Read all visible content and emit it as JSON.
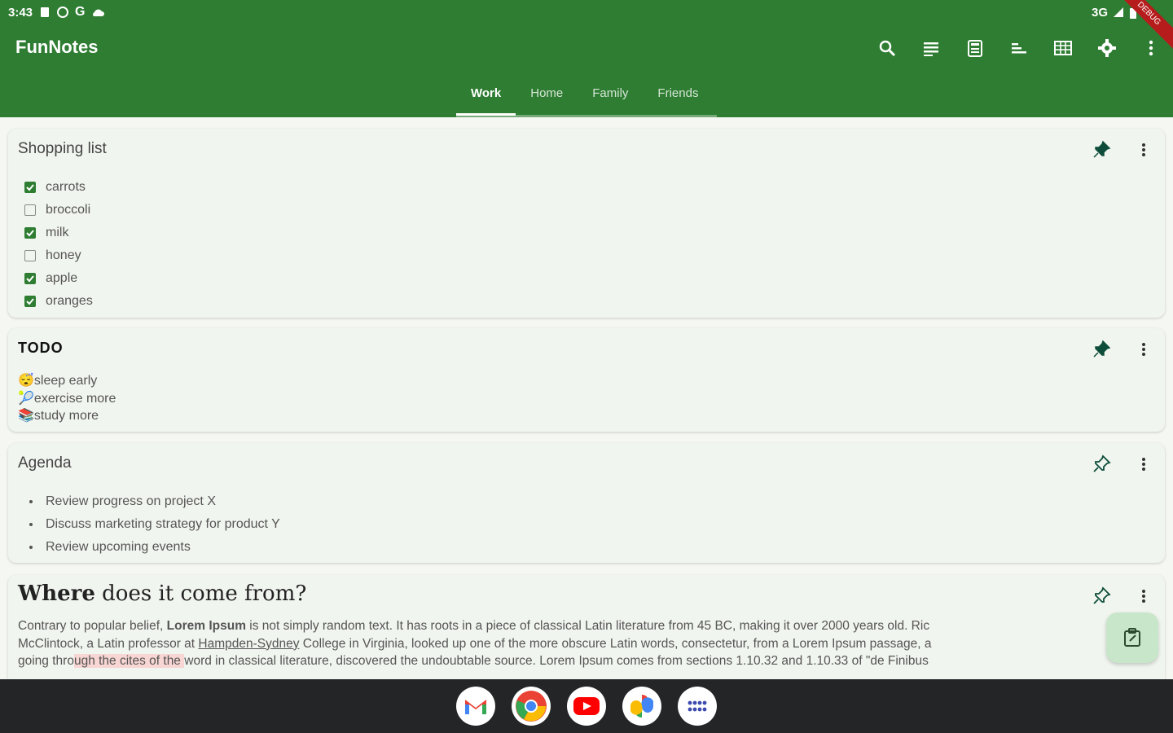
{
  "status": {
    "time": "3:43",
    "network": "3G"
  },
  "debug_banner": "DEBUG",
  "app": {
    "title": "FunNotes"
  },
  "toolbar_icons": [
    "search-icon",
    "list-view-icon",
    "calculator-icon",
    "sort-icon",
    "grid-view-icon",
    "settings-icon",
    "more-vert-icon"
  ],
  "tabs": [
    {
      "label": "Work",
      "active": true
    },
    {
      "label": "Home",
      "active": false
    },
    {
      "label": "Family",
      "active": false
    },
    {
      "label": "Friends",
      "active": false
    }
  ],
  "notes": {
    "shopping": {
      "title": "Shopping list",
      "items": [
        {
          "label": "carrots",
          "checked": true
        },
        {
          "label": "broccoli",
          "checked": false
        },
        {
          "label": "milk",
          "checked": true
        },
        {
          "label": "honey",
          "checked": false
        },
        {
          "label": "apple",
          "checked": true
        },
        {
          "label": "oranges",
          "checked": true
        }
      ]
    },
    "todo": {
      "title": "TODO",
      "lines": [
        "😴sleep early",
        "🎾exercise more",
        "📚study more"
      ]
    },
    "agenda": {
      "title": "Agenda",
      "items": [
        "Review progress on project X",
        "Discuss marketing strategy for product Y",
        "Review upcoming events"
      ]
    },
    "lorem": {
      "title_strong": "Where",
      "title_rest": " does it come from?",
      "p1_a": "Contrary to popular belief, ",
      "p1_bold": "Lorem Ipsum",
      "p1_b": " is not simply random text. It has roots in a piece of classical Latin literature from 45 BC, making it over 2000 years old. Ric",
      "p2_a": "McClintock, a Latin professor at ",
      "p2_link": "Hampden-Sydney",
      "p2_b": " College in Virginia, looked up one of the more obscure Latin words, consectetur, from a Lorem Ipsum passage, a",
      "p3_a": "going thro",
      "p3_hl": "ugh the cites of the ",
      "p3_b": "word in classical literature, discovered the undoubtable source. Lorem Ipsum comes from sections 1.10.32 and 1.10.33 of \"de Finibus"
    }
  },
  "colors": {
    "primary": "#2e7d32",
    "card": "#f1f5ef",
    "fab": "#c8e6c9"
  },
  "dock_apps": [
    "gmail-icon",
    "chrome-icon",
    "youtube-icon",
    "photos-icon",
    "apps-icon"
  ]
}
